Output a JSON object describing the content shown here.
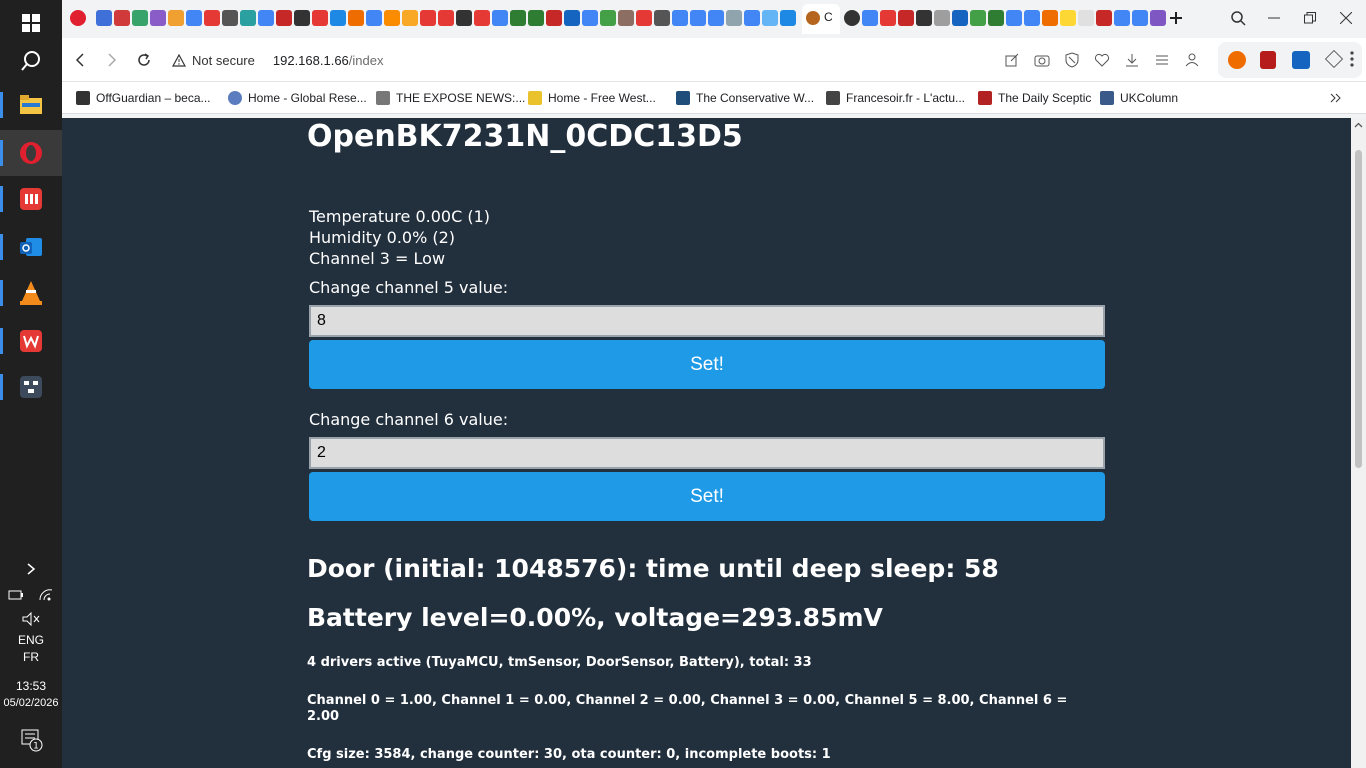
{
  "browser": {
    "address": {
      "security_label": "Not secure",
      "host": "192.168.1.66",
      "path": "/index"
    },
    "bookmarks": [
      {
        "label": "OffGuardian – beca...",
        "color": "#333333"
      },
      {
        "label": "Home - Global Rese...",
        "color": "#5b7dbf"
      },
      {
        "label": "THE EXPOSE NEWS:...",
        "color": "#777777"
      },
      {
        "label": "Home - Free West...",
        "color": "#e9c22c"
      },
      {
        "label": "The Conservative W...",
        "color": "#1e4e79"
      },
      {
        "label": "Francesoir.fr - L'actu...",
        "color": "#444444"
      },
      {
        "label": "The Daily Sceptic",
        "color": "#b22222"
      },
      {
        "label": "UKColumn",
        "color": "#3a5a8a"
      }
    ],
    "active_tab_label": "C"
  },
  "taskbar": {
    "lang_primary": "ENG",
    "lang_secondary": "FR",
    "time": "13:53",
    "date": "05/02/2026",
    "notification_count": "1"
  },
  "page": {
    "title": "OpenBK7231N_0CDC13D5",
    "temperature_line": "Temperature 0.00C (1)",
    "humidity_line": "Humidity 0.0% (2)",
    "channel3_line": "Channel 3 = Low",
    "ch5": {
      "label": "Change channel 5 value:",
      "value": "8",
      "button": "Set!"
    },
    "ch6": {
      "label": "Change channel 6 value:",
      "value": "2",
      "button": "Set!"
    },
    "door_line": "Door (initial: 1048576): time until deep sleep: 58",
    "battery_line": "Battery level=0.00%, voltage=293.85mV",
    "drivers_line": "4 drivers active (TuyaMCU, tmSensor, DoorSensor, Battery), total: 33",
    "channels_line": "Channel 0 = 1.00, Channel 1 = 0.00, Channel 2 = 0.00, Channel 3 = 0.00, Channel 5 = 8.00, Channel 6 = 2.00",
    "cfg_line": "Cfg size: 3584, change counter: 30, ota counter: 0, incomplete boots: 1"
  },
  "colors": {
    "page_background": "#222f3d",
    "button_blue": "#1e9ae6"
  }
}
